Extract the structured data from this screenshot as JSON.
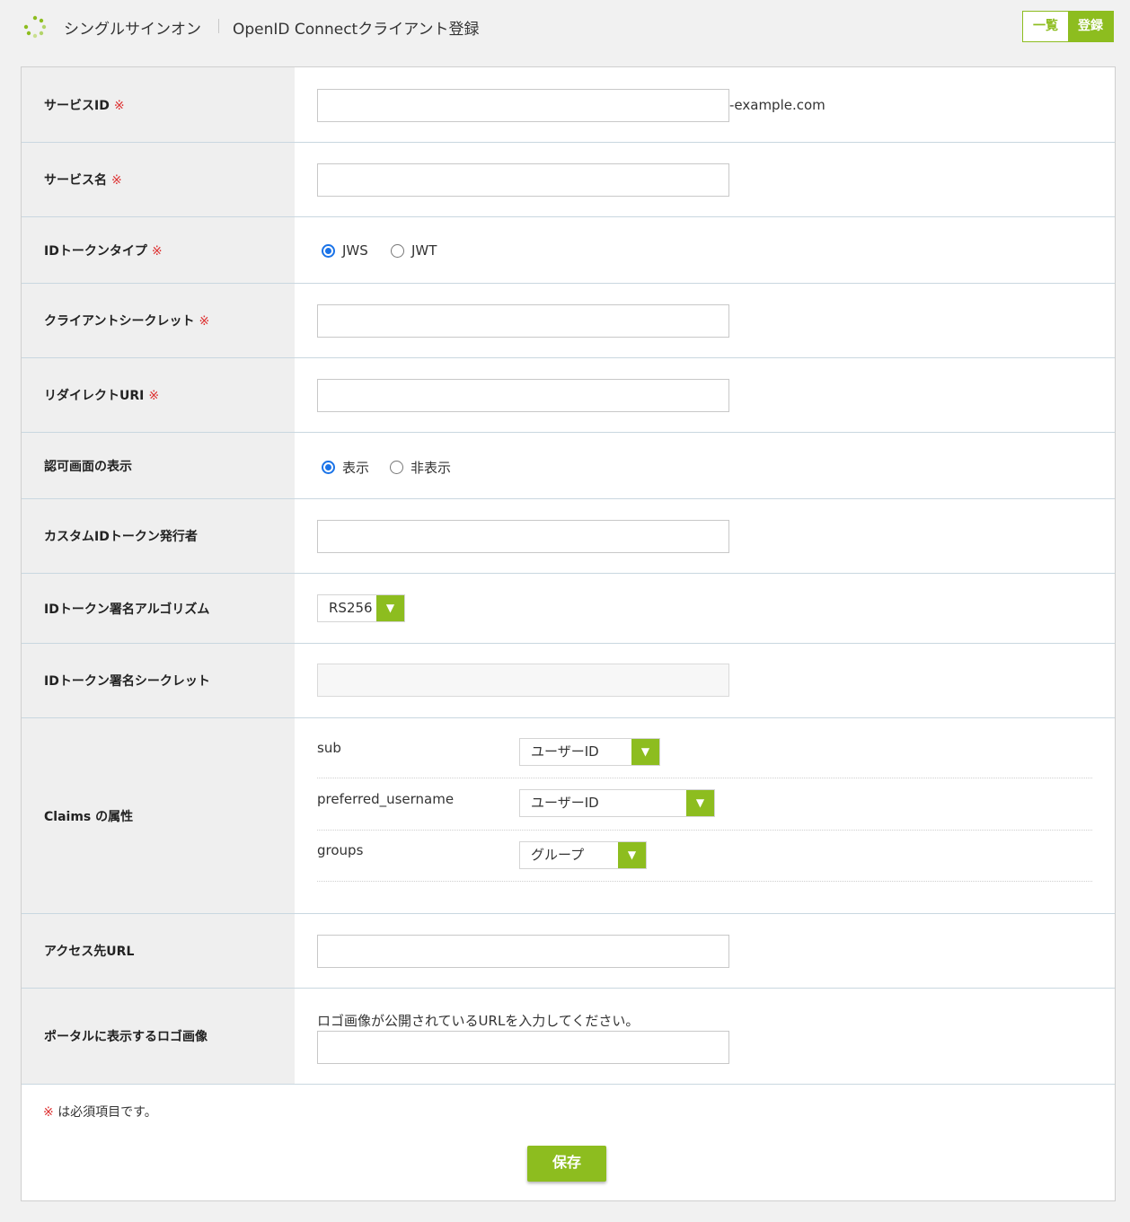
{
  "header": {
    "app_name": "シングルサインオン",
    "page_title": "OpenID Connectクライアント登録",
    "tabs": [
      {
        "label": "一覧",
        "active": false
      },
      {
        "label": "登録",
        "active": true
      }
    ]
  },
  "colors": {
    "accent": "#8dbd1f",
    "required": "#dd3333",
    "radio": "#1a73e8"
  },
  "required_mark": "※",
  "form": {
    "service_id": {
      "label": "サービスID",
      "required": true,
      "value": "",
      "suffix": "-example.com"
    },
    "service_name": {
      "label": "サービス名",
      "required": true,
      "value": ""
    },
    "id_token_type": {
      "label": "IDトークンタイプ",
      "required": true,
      "options": [
        "JWS",
        "JWT"
      ],
      "selected": "JWS"
    },
    "client_secret": {
      "label": "クライアントシークレット",
      "required": true,
      "value": ""
    },
    "redirect_uri": {
      "label": "リダイレクトURI",
      "required": true,
      "value": ""
    },
    "consent_display": {
      "label": "認可画面の表示",
      "options": [
        "表示",
        "非表示"
      ],
      "selected": "表示"
    },
    "custom_issuer": {
      "label": "カスタムIDトークン発行者",
      "value": ""
    },
    "sign_algorithm": {
      "label": "IDトークン署名アルゴリズム",
      "value": "RS256"
    },
    "sign_secret": {
      "label": "IDトークン署名シークレット",
      "value": ""
    },
    "claims": {
      "label": "Claims の属性",
      "items": [
        {
          "key": "sub",
          "value": "ユーザーID"
        },
        {
          "key": "preferred_username",
          "value": "ユーザーID"
        },
        {
          "key": "groups",
          "value": "グループ"
        }
      ]
    },
    "access_url": {
      "label": "アクセス先URL",
      "value": ""
    },
    "logo_image": {
      "label": "ポータルに表示するロゴ画像",
      "hint": "ロゴ画像が公開されているURLを入力してください。",
      "value": ""
    }
  },
  "footer": {
    "note": "は必須項目です。",
    "save_label": "保存"
  }
}
